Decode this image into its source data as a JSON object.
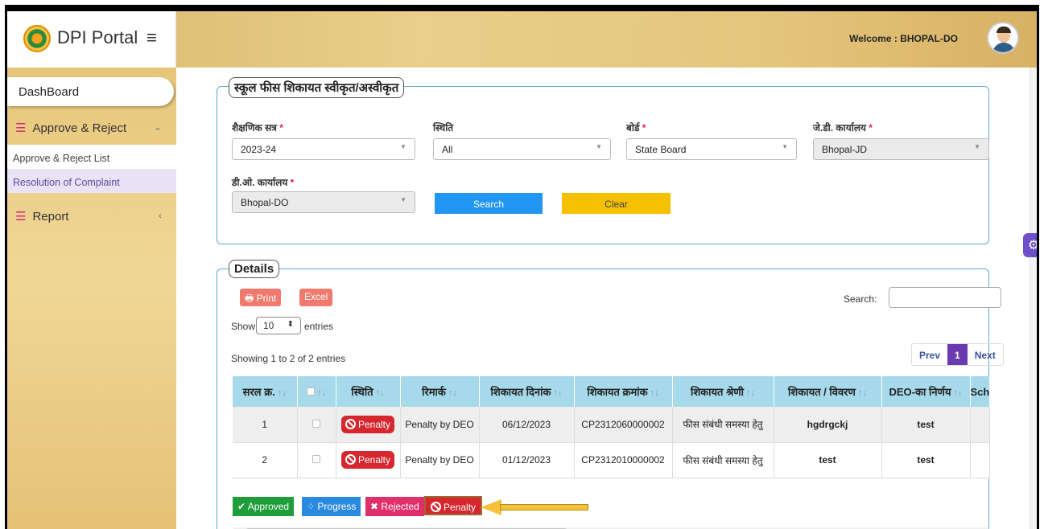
{
  "header": {
    "brand": "DPI Portal",
    "menu_icon": "hamburger-icon",
    "welcome": "Welcome : BHOPAL-DO"
  },
  "sidebar": {
    "dashboard": "DashBoard",
    "approve_reject": "Approve & Reject",
    "sub_items": [
      "Approve & Reject List",
      "Resolution of Complaint"
    ],
    "report": "Report"
  },
  "filters": {
    "legend": "स्कूल फीस शिकायत स्वीकृत/अस्वीकृत",
    "session_label": "शैक्षणिक सत्र",
    "session_value": "2023-24",
    "status_label": "स्थिति",
    "status_value": "All",
    "board_label": "बोर्ड",
    "board_value": "State Board",
    "jd_label": "जे.डी. कार्यालय",
    "jd_value": "Bhopal-JD",
    "do_label": "डी.ओ. कार्यालय",
    "do_value": "Bhopal-DO",
    "required_mark": "*",
    "search_btn": "Search",
    "clear_btn": "Clear"
  },
  "details": {
    "legend": "Details",
    "print": "Print",
    "excel": "Excel",
    "show": "Show",
    "entries_value": "10",
    "entries": "entries",
    "search_label": "Search:",
    "info": "Showing 1 to 2 of 2 entries",
    "prev": "Prev",
    "page": "1",
    "next": "Next"
  },
  "table": {
    "columns": [
      "सरल क्र.",
      "",
      "स्थिति",
      "रिमार्क",
      "शिकायत दिनांक",
      "शिकायत क्रमांक",
      "शिकायत श्रेणी",
      "शिकायत / विवरण",
      "DEO-का निर्णय",
      "Schoo"
    ],
    "rows": [
      {
        "sno": "1",
        "status": "Penalty",
        "remark": "Penalty by DEO",
        "date": "06/12/2023",
        "number": "CP2312060000002",
        "category": "फीस संबंधी समस्या हेतु",
        "description": "hgdrgckj",
        "deo": "test",
        "school": ""
      },
      {
        "sno": "2",
        "status": "Penalty",
        "remark": "Penalty by DEO",
        "date": "01/12/2023",
        "number": "CP2312010000002",
        "category": "फीस संबंधी समस्या हेतु",
        "description": "test",
        "deo": "test",
        "school": ""
      }
    ]
  },
  "legend_buttons": {
    "approved": "Approved",
    "progress": "Progress",
    "rejected": "Rejected",
    "penalty": "Penalty"
  },
  "colors": {
    "header_gold": "#e9cf8a",
    "table_header": "#a6d9ea",
    "penalty_red": "#d6262e",
    "search_blue": "#2196f3",
    "clear_yellow": "#f5c000"
  }
}
